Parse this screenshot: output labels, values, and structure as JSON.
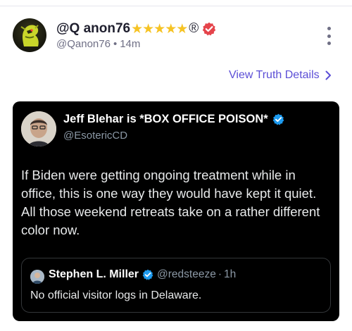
{
  "post": {
    "display_name": "@Q anon76",
    "stars": "★★★★★",
    "registered_mark": "®",
    "handle": "@Qanon76",
    "separator": "•",
    "time": "14m",
    "view_details_label": "View Truth Details"
  },
  "embed": {
    "author_name": "Jeff Blehar is *BOX OFFICE POISON*",
    "author_handle": "@EsotericCD",
    "text": "If Biden were getting ongoing treatment while in office, this is one way they would have kept it quiet. All those weekend retreats take on a rather different color now.",
    "quote": {
      "author_name": "Stephen L. Miller",
      "author_handle": "@redsteeze",
      "separator": "·",
      "time": "1h",
      "text": "No official visitor logs in Delaware."
    }
  },
  "colors": {
    "accent": "#5b4ed6",
    "verified_red": "#e5444b",
    "verified_blue": "#1d9bf0",
    "stars": "#f6c324"
  },
  "icons": [
    "avatar",
    "verified-badge-icon",
    "more-options-icon",
    "chevron-right-icon",
    "x-verified-icon"
  ]
}
